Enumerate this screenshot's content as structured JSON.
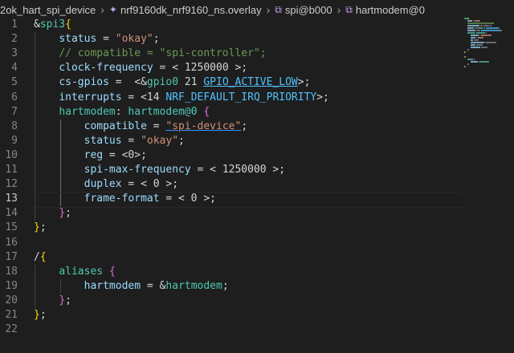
{
  "breadcrumb": {
    "items": [
      {
        "label": "2ok_hart_spi_device",
        "icon": ""
      },
      {
        "label": "nrf9160dk_nrf9160_ns.overlay",
        "icon": "devicetree-file-icon"
      },
      {
        "label": "spi@b000",
        "icon": "node-icon"
      },
      {
        "label": "hartmodem@0",
        "icon": "node-icon"
      }
    ]
  },
  "editor": {
    "active_line": 13,
    "lines": [
      {
        "num": "1",
        "tokens": [
          [
            "&",
            "t-amp"
          ],
          [
            "spi3",
            "t-node"
          ],
          [
            "{",
            "t-b1"
          ]
        ]
      },
      {
        "num": "2",
        "tokens": [
          [
            "    ",
            ""
          ],
          [
            "status",
            "t-prop"
          ],
          [
            " = ",
            ""
          ],
          [
            "\"okay\"",
            "t-str"
          ],
          [
            ";",
            ""
          ]
        ]
      },
      {
        "num": "3",
        "tokens": [
          [
            "    ",
            ""
          ],
          [
            "// compatible = \"spi-controller\";",
            "t-com"
          ]
        ]
      },
      {
        "num": "4",
        "tokens": [
          [
            "    ",
            ""
          ],
          [
            "clock-frequency",
            "t-prop"
          ],
          [
            " = < ",
            ""
          ],
          [
            "1250000",
            "t-num"
          ],
          [
            " >;",
            ""
          ]
        ]
      },
      {
        "num": "5",
        "tokens": [
          [
            "    ",
            ""
          ],
          [
            "cs-gpios",
            "t-prop"
          ],
          [
            " =  <&",
            ""
          ],
          [
            "gpio0",
            "t-node"
          ],
          [
            " 21 ",
            ""
          ],
          [
            "GPIO_ACTIVE_LOW",
            "t-const-link"
          ],
          [
            ">;",
            ""
          ]
        ]
      },
      {
        "num": "6",
        "tokens": [
          [
            "    ",
            ""
          ],
          [
            "interrupts",
            "t-prop"
          ],
          [
            " = <14 ",
            ""
          ],
          [
            "NRF_DEFAULT_IRQ_PRIORITY",
            "t-const"
          ],
          [
            ">;",
            ""
          ]
        ]
      },
      {
        "num": "7",
        "tokens": [
          [
            "    ",
            ""
          ],
          [
            "hartmodem",
            "t-label"
          ],
          [
            ": ",
            ""
          ],
          [
            "hartmodem@0",
            "t-node"
          ],
          [
            " ",
            ""
          ],
          [
            "{",
            "t-b2"
          ]
        ]
      },
      {
        "num": "8",
        "tokens": [
          [
            "        ",
            ""
          ],
          [
            "compatible",
            "t-prop"
          ],
          [
            " = ",
            ""
          ],
          [
            "\"spi-device\"",
            "t-str-link"
          ],
          [
            ";",
            ""
          ]
        ]
      },
      {
        "num": "9",
        "tokens": [
          [
            "        ",
            ""
          ],
          [
            "status",
            "t-prop"
          ],
          [
            " = ",
            ""
          ],
          [
            "\"okay\"",
            "t-str"
          ],
          [
            ";",
            ""
          ]
        ]
      },
      {
        "num": "10",
        "tokens": [
          [
            "        ",
            ""
          ],
          [
            "reg",
            "t-prop"
          ],
          [
            " = <0>;",
            ""
          ]
        ]
      },
      {
        "num": "11",
        "tokens": [
          [
            "        ",
            ""
          ],
          [
            "spi-max-frequency",
            "t-prop"
          ],
          [
            " = < 1250000 >;",
            ""
          ]
        ]
      },
      {
        "num": "12",
        "tokens": [
          [
            "        ",
            ""
          ],
          [
            "duplex",
            "t-prop"
          ],
          [
            " = < 0 >;",
            ""
          ]
        ]
      },
      {
        "num": "13",
        "tokens": [
          [
            "        ",
            ""
          ],
          [
            "frame-format",
            "t-prop"
          ],
          [
            " = < 0 >;",
            ""
          ]
        ]
      },
      {
        "num": "14",
        "tokens": [
          [
            "    ",
            ""
          ],
          [
            "}",
            "t-b2"
          ],
          [
            ";",
            ""
          ]
        ]
      },
      {
        "num": "15",
        "tokens": [
          [
            "}",
            "t-b1"
          ],
          [
            ";",
            ""
          ]
        ]
      },
      {
        "num": "16",
        "tokens": []
      },
      {
        "num": "17",
        "tokens": [
          [
            "/",
            "t-amp"
          ],
          [
            "{",
            "t-b1"
          ]
        ]
      },
      {
        "num": "18",
        "tokens": [
          [
            "    ",
            ""
          ],
          [
            "aliases",
            "t-node"
          ],
          [
            " ",
            ""
          ],
          [
            "{",
            "t-b2"
          ]
        ]
      },
      {
        "num": "19",
        "tokens": [
          [
            "        ",
            ""
          ],
          [
            "hartmodem",
            "t-prop"
          ],
          [
            " = &",
            ""
          ],
          [
            "hartmodem",
            "t-node"
          ],
          [
            ";",
            ""
          ]
        ]
      },
      {
        "num": "20",
        "tokens": [
          [
            "    ",
            ""
          ],
          [
            "}",
            "t-b2"
          ],
          [
            ";",
            ""
          ]
        ]
      },
      {
        "num": "21",
        "tokens": [
          [
            "}",
            "t-b1"
          ],
          [
            ";",
            ""
          ]
        ]
      },
      {
        "num": "22",
        "tokens": []
      }
    ]
  },
  "colors": {
    "background": "#1e1e1e",
    "property": "#9cdcfe",
    "string": "#ce9178",
    "comment": "#6a9955",
    "node": "#4ec9b0",
    "constant": "#4fc1ff"
  }
}
